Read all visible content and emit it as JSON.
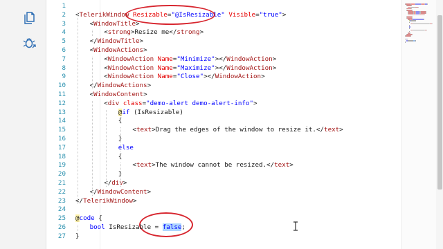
{
  "icons": {
    "explorer": "files-icon",
    "debug": "debug-bug-icon"
  },
  "colors": {
    "annotation": "#d7262f",
    "tag": "#a31515",
    "attribute": "#e50000",
    "value": "#0000ff",
    "line_number": "#2b91af",
    "selection": "#add6ff"
  },
  "editor": {
    "lines": [
      {
        "n": "1",
        "indent": 0,
        "tokens": []
      },
      {
        "n": "2",
        "indent": 0,
        "tokens": [
          [
            "d",
            "<"
          ],
          [
            "t",
            "TelerikWindow"
          ],
          [
            "d",
            " "
          ],
          [
            "a",
            "Resizable"
          ],
          [
            "d",
            "="
          ],
          [
            "s",
            "\"@IsResizable\""
          ],
          [
            "d",
            " "
          ],
          [
            "a",
            "Visible"
          ],
          [
            "d",
            "="
          ],
          [
            "s",
            "\"true\""
          ],
          [
            "d",
            ">"
          ]
        ]
      },
      {
        "n": "3",
        "indent": 1,
        "tokens": [
          [
            "d",
            "<"
          ],
          [
            "t",
            "WindowTitle"
          ],
          [
            "d",
            ">"
          ]
        ]
      },
      {
        "n": "4",
        "indent": 2,
        "tokens": [
          [
            "d",
            "<"
          ],
          [
            "t",
            "strong"
          ],
          [
            "d",
            ">"
          ],
          [
            "i",
            "Resize me"
          ],
          [
            "d",
            "</"
          ],
          [
            "t",
            "strong"
          ],
          [
            "d",
            ">"
          ]
        ]
      },
      {
        "n": "5",
        "indent": 1,
        "tokens": [
          [
            "d",
            "</"
          ],
          [
            "t",
            "WindowTitle"
          ],
          [
            "d",
            ">"
          ]
        ]
      },
      {
        "n": "6",
        "indent": 1,
        "tokens": [
          [
            "d",
            "<"
          ],
          [
            "t",
            "WindowActions"
          ],
          [
            "d",
            ">"
          ]
        ]
      },
      {
        "n": "7",
        "indent": 2,
        "tokens": [
          [
            "d",
            "<"
          ],
          [
            "t",
            "WindowAction"
          ],
          [
            "d",
            " "
          ],
          [
            "a",
            "Name"
          ],
          [
            "d",
            "="
          ],
          [
            "s",
            "\"Minimize\""
          ],
          [
            "d",
            "></"
          ],
          [
            "t",
            "WindowAction"
          ],
          [
            "d",
            ">"
          ]
        ]
      },
      {
        "n": "8",
        "indent": 2,
        "tokens": [
          [
            "d",
            "<"
          ],
          [
            "t",
            "WindowAction"
          ],
          [
            "d",
            " "
          ],
          [
            "a",
            "Name"
          ],
          [
            "d",
            "="
          ],
          [
            "s",
            "\"Maximize\""
          ],
          [
            "d",
            "></"
          ],
          [
            "t",
            "WindowAction"
          ],
          [
            "d",
            ">"
          ]
        ]
      },
      {
        "n": "9",
        "indent": 2,
        "tokens": [
          [
            "d",
            "<"
          ],
          [
            "t",
            "WindowAction"
          ],
          [
            "d",
            " "
          ],
          [
            "a",
            "Name"
          ],
          [
            "d",
            "="
          ],
          [
            "s",
            "\"Close\""
          ],
          [
            "d",
            "></"
          ],
          [
            "t",
            "WindowAction"
          ],
          [
            "d",
            ">"
          ]
        ]
      },
      {
        "n": "10",
        "indent": 1,
        "tokens": [
          [
            "d",
            "</"
          ],
          [
            "t",
            "WindowActions"
          ],
          [
            "d",
            ">"
          ]
        ]
      },
      {
        "n": "11",
        "indent": 1,
        "tokens": [
          [
            "d",
            "<"
          ],
          [
            "t",
            "WindowContent"
          ],
          [
            "d",
            ">"
          ]
        ]
      },
      {
        "n": "12",
        "indent": 2,
        "tokens": [
          [
            "d",
            "<"
          ],
          [
            "t",
            "div"
          ],
          [
            "d",
            " "
          ],
          [
            "a",
            "class"
          ],
          [
            "d",
            "="
          ],
          [
            "s",
            "\"demo-alert demo-alert-info\""
          ],
          [
            "d",
            ">"
          ]
        ]
      },
      {
        "n": "13",
        "indent": 3,
        "tokens": [
          [
            "r",
            "@"
          ],
          [
            "k",
            "if"
          ],
          [
            "i",
            " (IsResizable)"
          ]
        ]
      },
      {
        "n": "14",
        "indent": 3,
        "tokens": [
          [
            "i",
            "{"
          ]
        ]
      },
      {
        "n": "15",
        "indent": 4,
        "tokens": [
          [
            "d",
            "<"
          ],
          [
            "t",
            "text"
          ],
          [
            "d",
            ">"
          ],
          [
            "i",
            "Drag the edges of the window to resize it."
          ],
          [
            "d",
            "</"
          ],
          [
            "t",
            "text"
          ],
          [
            "d",
            ">"
          ]
        ]
      },
      {
        "n": "16",
        "indent": 3,
        "tokens": [
          [
            "i",
            "}"
          ]
        ]
      },
      {
        "n": "17",
        "indent": 3,
        "tokens": [
          [
            "k",
            "else"
          ]
        ]
      },
      {
        "n": "18",
        "indent": 3,
        "tokens": [
          [
            "i",
            "{"
          ]
        ]
      },
      {
        "n": "19",
        "indent": 4,
        "tokens": [
          [
            "d",
            "<"
          ],
          [
            "t",
            "text"
          ],
          [
            "d",
            ">"
          ],
          [
            "i",
            "The window cannot be resized."
          ],
          [
            "d",
            "</"
          ],
          [
            "t",
            "text"
          ],
          [
            "d",
            ">"
          ]
        ]
      },
      {
        "n": "20",
        "indent": 3,
        "tokens": [
          [
            "i",
            "}"
          ]
        ]
      },
      {
        "n": "21",
        "indent": 2,
        "tokens": [
          [
            "d",
            "</"
          ],
          [
            "t",
            "div"
          ],
          [
            "d",
            ">"
          ]
        ]
      },
      {
        "n": "22",
        "indent": 1,
        "tokens": [
          [
            "d",
            "</"
          ],
          [
            "t",
            "WindowContent"
          ],
          [
            "d",
            ">"
          ]
        ]
      },
      {
        "n": "23",
        "indent": 0,
        "tokens": [
          [
            "d",
            "</"
          ],
          [
            "t",
            "TelerikWindow"
          ],
          [
            "d",
            ">"
          ]
        ]
      },
      {
        "n": "24",
        "indent": 0,
        "tokens": []
      },
      {
        "n": "25",
        "indent": 0,
        "tokens": [
          [
            "r",
            "@"
          ],
          [
            "k",
            "code"
          ],
          [
            "i",
            " {"
          ]
        ]
      },
      {
        "n": "26",
        "indent": 1,
        "tokens": [
          [
            "k",
            "bool"
          ],
          [
            "i",
            " IsResizable = "
          ],
          [
            "sel",
            "false"
          ],
          [
            "i",
            ";"
          ]
        ]
      },
      {
        "n": "27",
        "indent": 0,
        "tokens": [
          [
            "i",
            "}"
          ]
        ]
      }
    ]
  }
}
